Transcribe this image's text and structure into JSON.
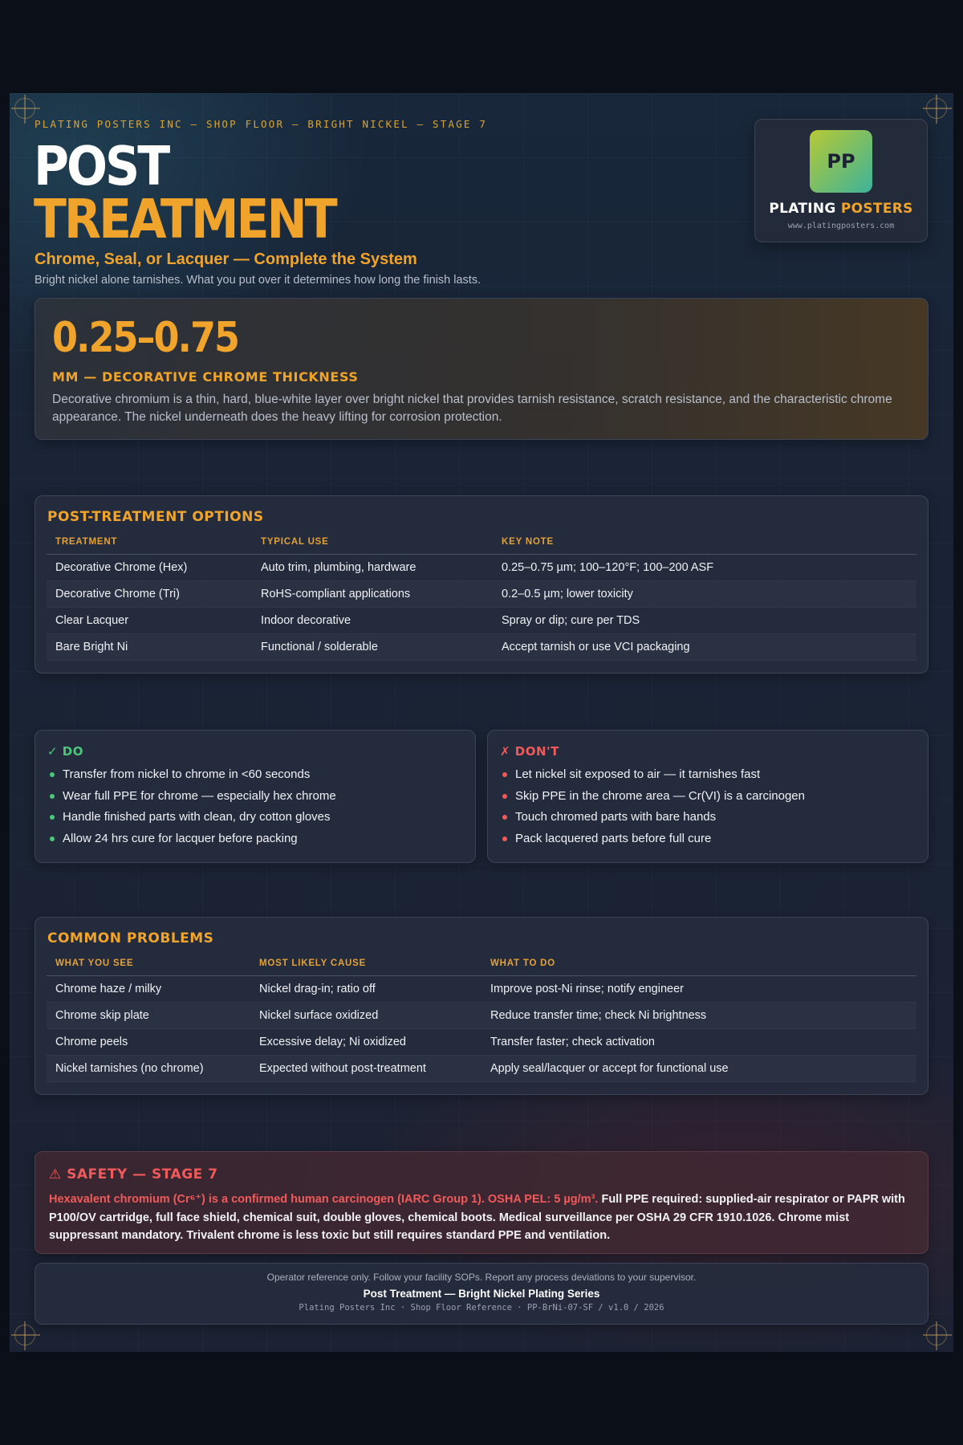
{
  "header": {
    "overline": "PLATING POSTERS INC — SHOP FLOOR — BRIGHT NICKEL — STAGE 7",
    "title_line1": "POST",
    "title_line2": "TREATMENT",
    "subtitle": "Chrome, Seal, or Lacquer — Complete the System",
    "lede": "Bright nickel alone tarnishes. What you put over it determines how long the finish lasts."
  },
  "brand": {
    "logo_text": "PP",
    "name_first": "PLATING",
    "name_second": "POSTERS",
    "url": "www.platingposters.com"
  },
  "hero": {
    "value": "0.25–0.75",
    "label": "MM — DECORATIVE CHROME THICKNESS",
    "text": "Decorative chromium is a thin, hard, blue-white layer over bright nickel that provides tarnish resistance, scratch resistance, and the characteristic chrome appearance. The nickel underneath does the heavy lifting for corrosion protection."
  },
  "options": {
    "title": "POST-TREATMENT OPTIONS",
    "headers": [
      "TREATMENT",
      "TYPICAL USE",
      "KEY NOTE"
    ],
    "rows": [
      [
        "Decorative Chrome (Hex)",
        "Auto trim, plumbing, hardware",
        "0.25–0.75 µm; 100–120°F; 100–200 ASF"
      ],
      [
        "Decorative Chrome (Tri)",
        "RoHS-compliant applications",
        "0.2–0.5 µm; lower toxicity"
      ],
      [
        "Clear Lacquer",
        "Indoor decorative",
        "Spray or dip; cure per TDS"
      ],
      [
        "Bare Bright Ni",
        "Functional / solderable",
        "Accept tarnish or use VCI packaging"
      ]
    ]
  },
  "do_list": {
    "icon": "check-icon",
    "title": "✓ DO",
    "items": [
      "Transfer from nickel to chrome in <60 seconds",
      "Wear full PPE for chrome — especially hex chrome",
      "Handle finished parts with clean, dry cotton gloves",
      "Allow 24 hrs cure for lacquer before packing"
    ]
  },
  "dont_list": {
    "icon": "x-icon",
    "title": "✗ DON'T",
    "items": [
      "Let nickel sit exposed to air — it tarnishes fast",
      "Skip PPE in the chrome area — Cr(VI) is a carcinogen",
      "Touch chromed parts with bare hands",
      "Pack lacquered parts before full cure"
    ]
  },
  "problems": {
    "title": "COMMON PROBLEMS",
    "headers": [
      "WHAT YOU SEE",
      "MOST LIKELY CAUSE",
      "WHAT TO DO"
    ],
    "rows": [
      [
        "Chrome haze / milky",
        "Nickel drag-in; ratio off",
        "Improve post-Ni rinse; notify engineer"
      ],
      [
        "Chrome skip plate",
        "Nickel surface oxidized",
        "Reduce transfer time; check Ni brightness"
      ],
      [
        "Chrome peels",
        "Excessive delay; Ni oxidized",
        "Transfer faster; check activation"
      ],
      [
        "Nickel tarnishes (no chrome)",
        "Expected without post-treatment",
        "Apply seal/lacquer or accept for functional use"
      ]
    ]
  },
  "safety": {
    "icon": "warning-icon",
    "title": "⚠ SAFETY — STAGE 7",
    "warning": "Hexavalent chromium (Cr⁶⁺) is a confirmed human carcinogen (IARC Group 1). OSHA PEL: 5 µg/m³.",
    "text": " Full PPE required: supplied-air respirator or PAPR with P100/OV cartridge, full face shield, chemical suit, double gloves, chemical boots. Medical surveillance per OSHA 29 CFR 1910.1026. Chrome mist suppressant mandatory. Trivalent chrome is less toxic but still requires standard PPE and ventilation."
  },
  "footer": {
    "note": "Operator reference only. Follow your facility SOPs. Report any process deviations to your supervisor.",
    "series": "Post Treatment — Bright Nickel Plating Series",
    "ref": "Plating Posters Inc · Shop Floor Reference · PP-BrNi-07-SF / v1.0 / 2026"
  },
  "colors": {
    "accent": "#f0a42c",
    "do": "#4cc77a",
    "dont": "#f05a5a",
    "background": "#1a2335"
  }
}
